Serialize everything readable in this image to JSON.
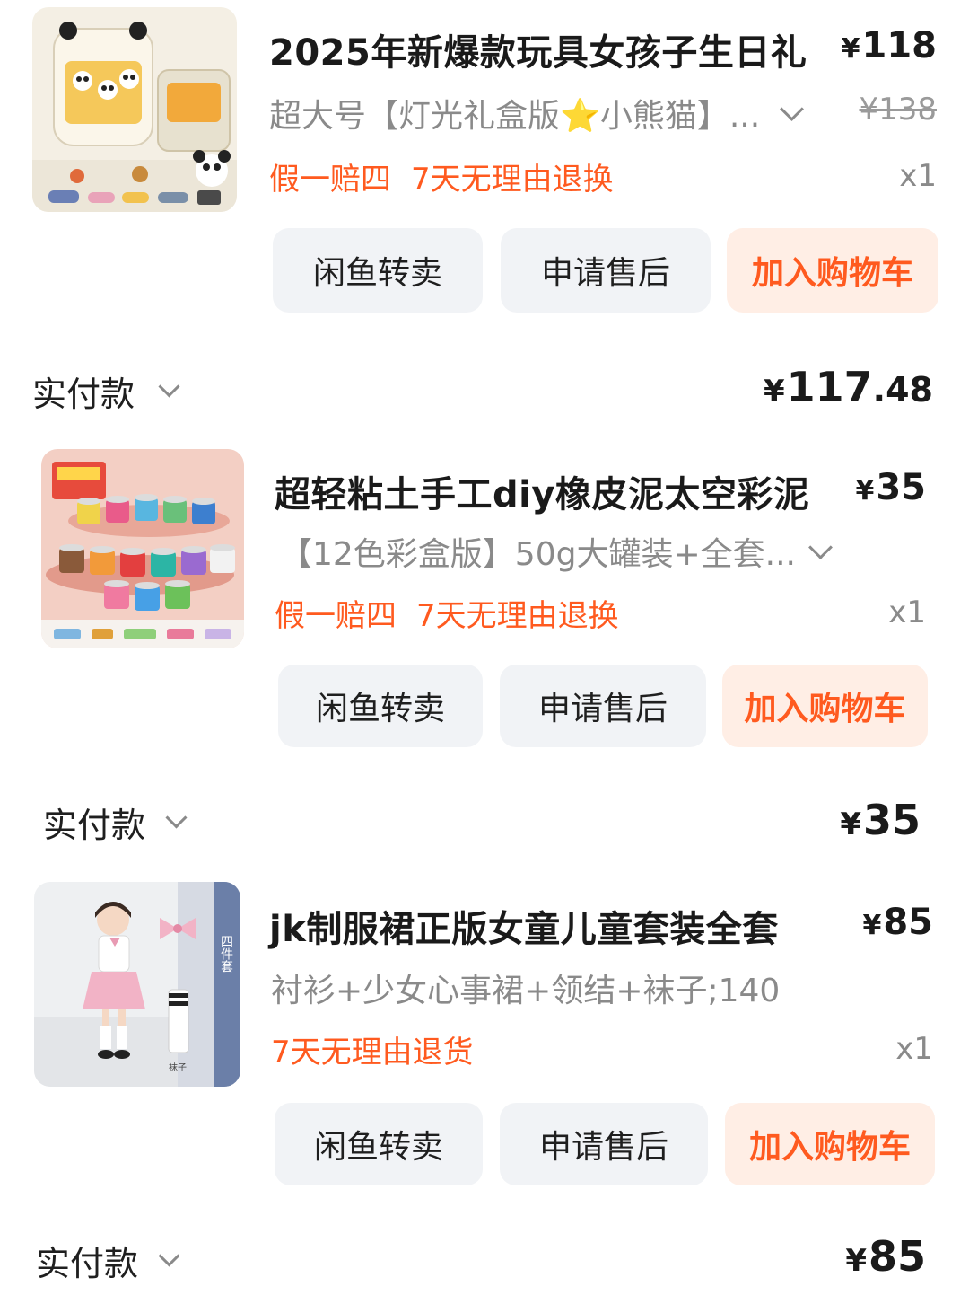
{
  "orders": [
    {
      "title": "2025年新爆款玩具女孩子生日礼",
      "currency": "¥",
      "price": "118",
      "original_price": "¥138",
      "spec": "超大号【灯光礼盒版⭐小熊猫】...",
      "tags": [
        "假一赔四",
        "7天无理由退换"
      ],
      "quantity": "x1",
      "buttons": [
        "闲鱼转卖",
        "申请售后",
        "加入购物车"
      ],
      "paid_label": "实付款",
      "paid_int": "117",
      "paid_dec": ".48",
      "image": "panda-toy-gift-box-image"
    },
    {
      "title": "超轻粘土手工diy橡皮泥太空彩泥",
      "currency": "¥",
      "price": "35",
      "spec": "【12色彩盒版】50g大罐装+全套...",
      "tags": [
        "假一赔四",
        "7天无理由退换"
      ],
      "quantity": "x1",
      "buttons": [
        "闲鱼转卖",
        "申请售后",
        "加入购物车"
      ],
      "paid_label": "实付款",
      "paid_int": "35",
      "paid_dec": "",
      "image": "clay-jars-image"
    },
    {
      "title": "jk制服裙正版女童儿童套装全套",
      "currency": "¥",
      "price": "85",
      "spec": "衬衫+少女心事裙+领结+袜子;140",
      "tags": [
        "7天无理由退货"
      ],
      "quantity": "x1",
      "buttons": [
        "闲鱼转卖",
        "申请售后",
        "加入购物车"
      ],
      "paid_label": "实付款",
      "paid_int": "85",
      "paid_dec": "",
      "image": "girl-jk-uniform-image",
      "image_side_text": "四件套",
      "image_caption": "袜子"
    }
  ],
  "colors": {
    "accent": "#ff5a1f",
    "cart_button_bg": "#ffeee5",
    "button_bg": "#f1f3f6",
    "muted_text": "#8a8a8a"
  }
}
